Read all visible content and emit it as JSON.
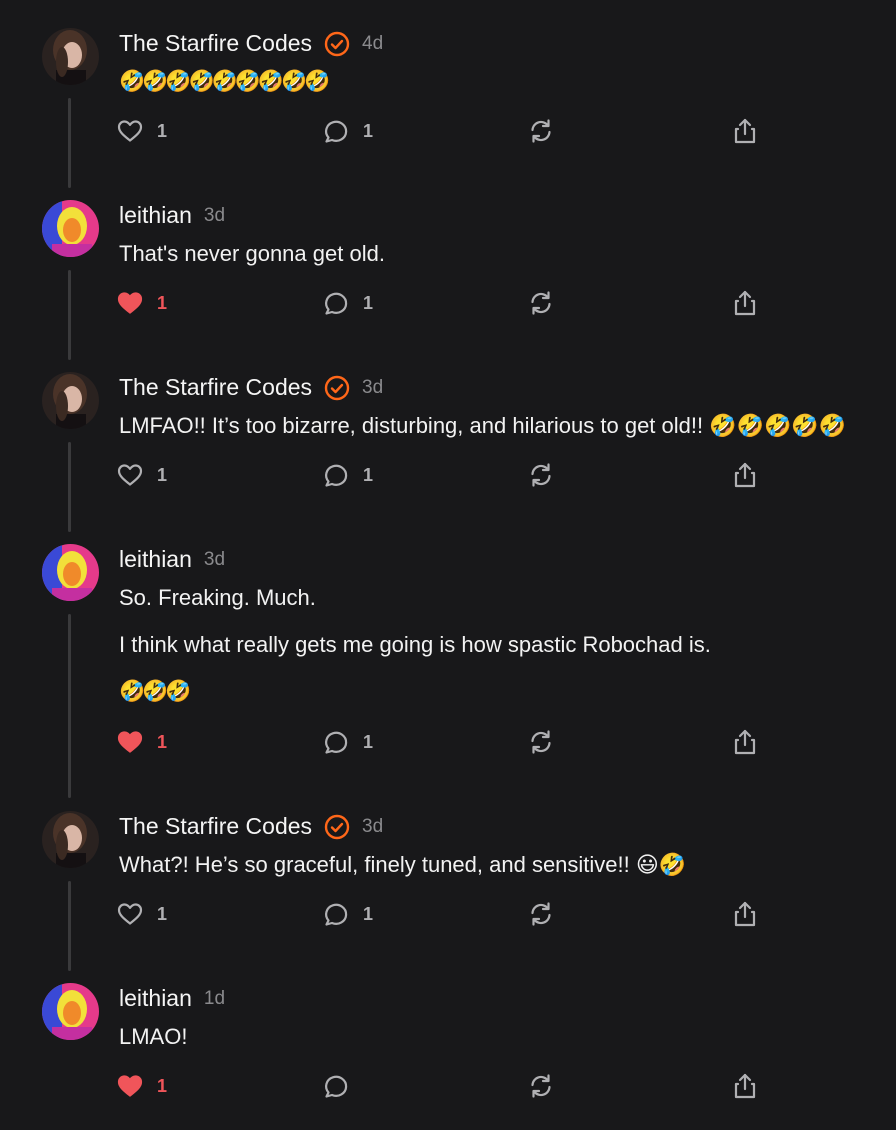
{
  "colors": {
    "background": "#18181a",
    "accent_verified": "#ff6719",
    "liked": "#f0555a",
    "muted": "#8a8a8d"
  },
  "icons": {
    "like": "heart-icon",
    "liked": "heart-filled-icon",
    "reply": "speech-bubble-icon",
    "restack": "restack-arrows-icon",
    "share": "share-upload-icon",
    "verified": "verified-check-icon"
  },
  "comments": [
    {
      "author": "The Starfire Codes",
      "verified": true,
      "time": "4d",
      "paragraphs": [
        "🤣🤣🤣🤣🤣🤣🤣🤣🤣"
      ],
      "likes": "1",
      "liked": false,
      "replies": "1"
    },
    {
      "author": "leithian",
      "verified": false,
      "time": "3d",
      "paragraphs": [
        "That's never gonna get old."
      ],
      "likes": "1",
      "liked": true,
      "replies": "1"
    },
    {
      "author": "The Starfire Codes",
      "verified": true,
      "time": "3d",
      "paragraphs": [
        "LMFAO!! It’s too bizarre, disturbing, and hilarious to get old!! 🤣🤣🤣🤣🤣"
      ],
      "likes": "1",
      "liked": false,
      "replies": "1"
    },
    {
      "author": "leithian",
      "verified": false,
      "time": "3d",
      "paragraphs": [
        "So. Freaking. Much.",
        "I think what really gets me going is how spastic Robochad is.",
        "🤣🤣🤣"
      ],
      "likes": "1",
      "liked": true,
      "replies": "1"
    },
    {
      "author": "The Starfire Codes",
      "verified": true,
      "time": "3d",
      "paragraphs": [
        "What?! He’s so graceful, finely tuned, and sensitive!! 😃🤣"
      ],
      "likes": "1",
      "liked": false,
      "replies": "1"
    },
    {
      "author": "leithian",
      "verified": false,
      "time": "1d",
      "paragraphs": [
        "LMAO!"
      ],
      "likes": "1",
      "liked": true,
      "replies": ""
    }
  ]
}
